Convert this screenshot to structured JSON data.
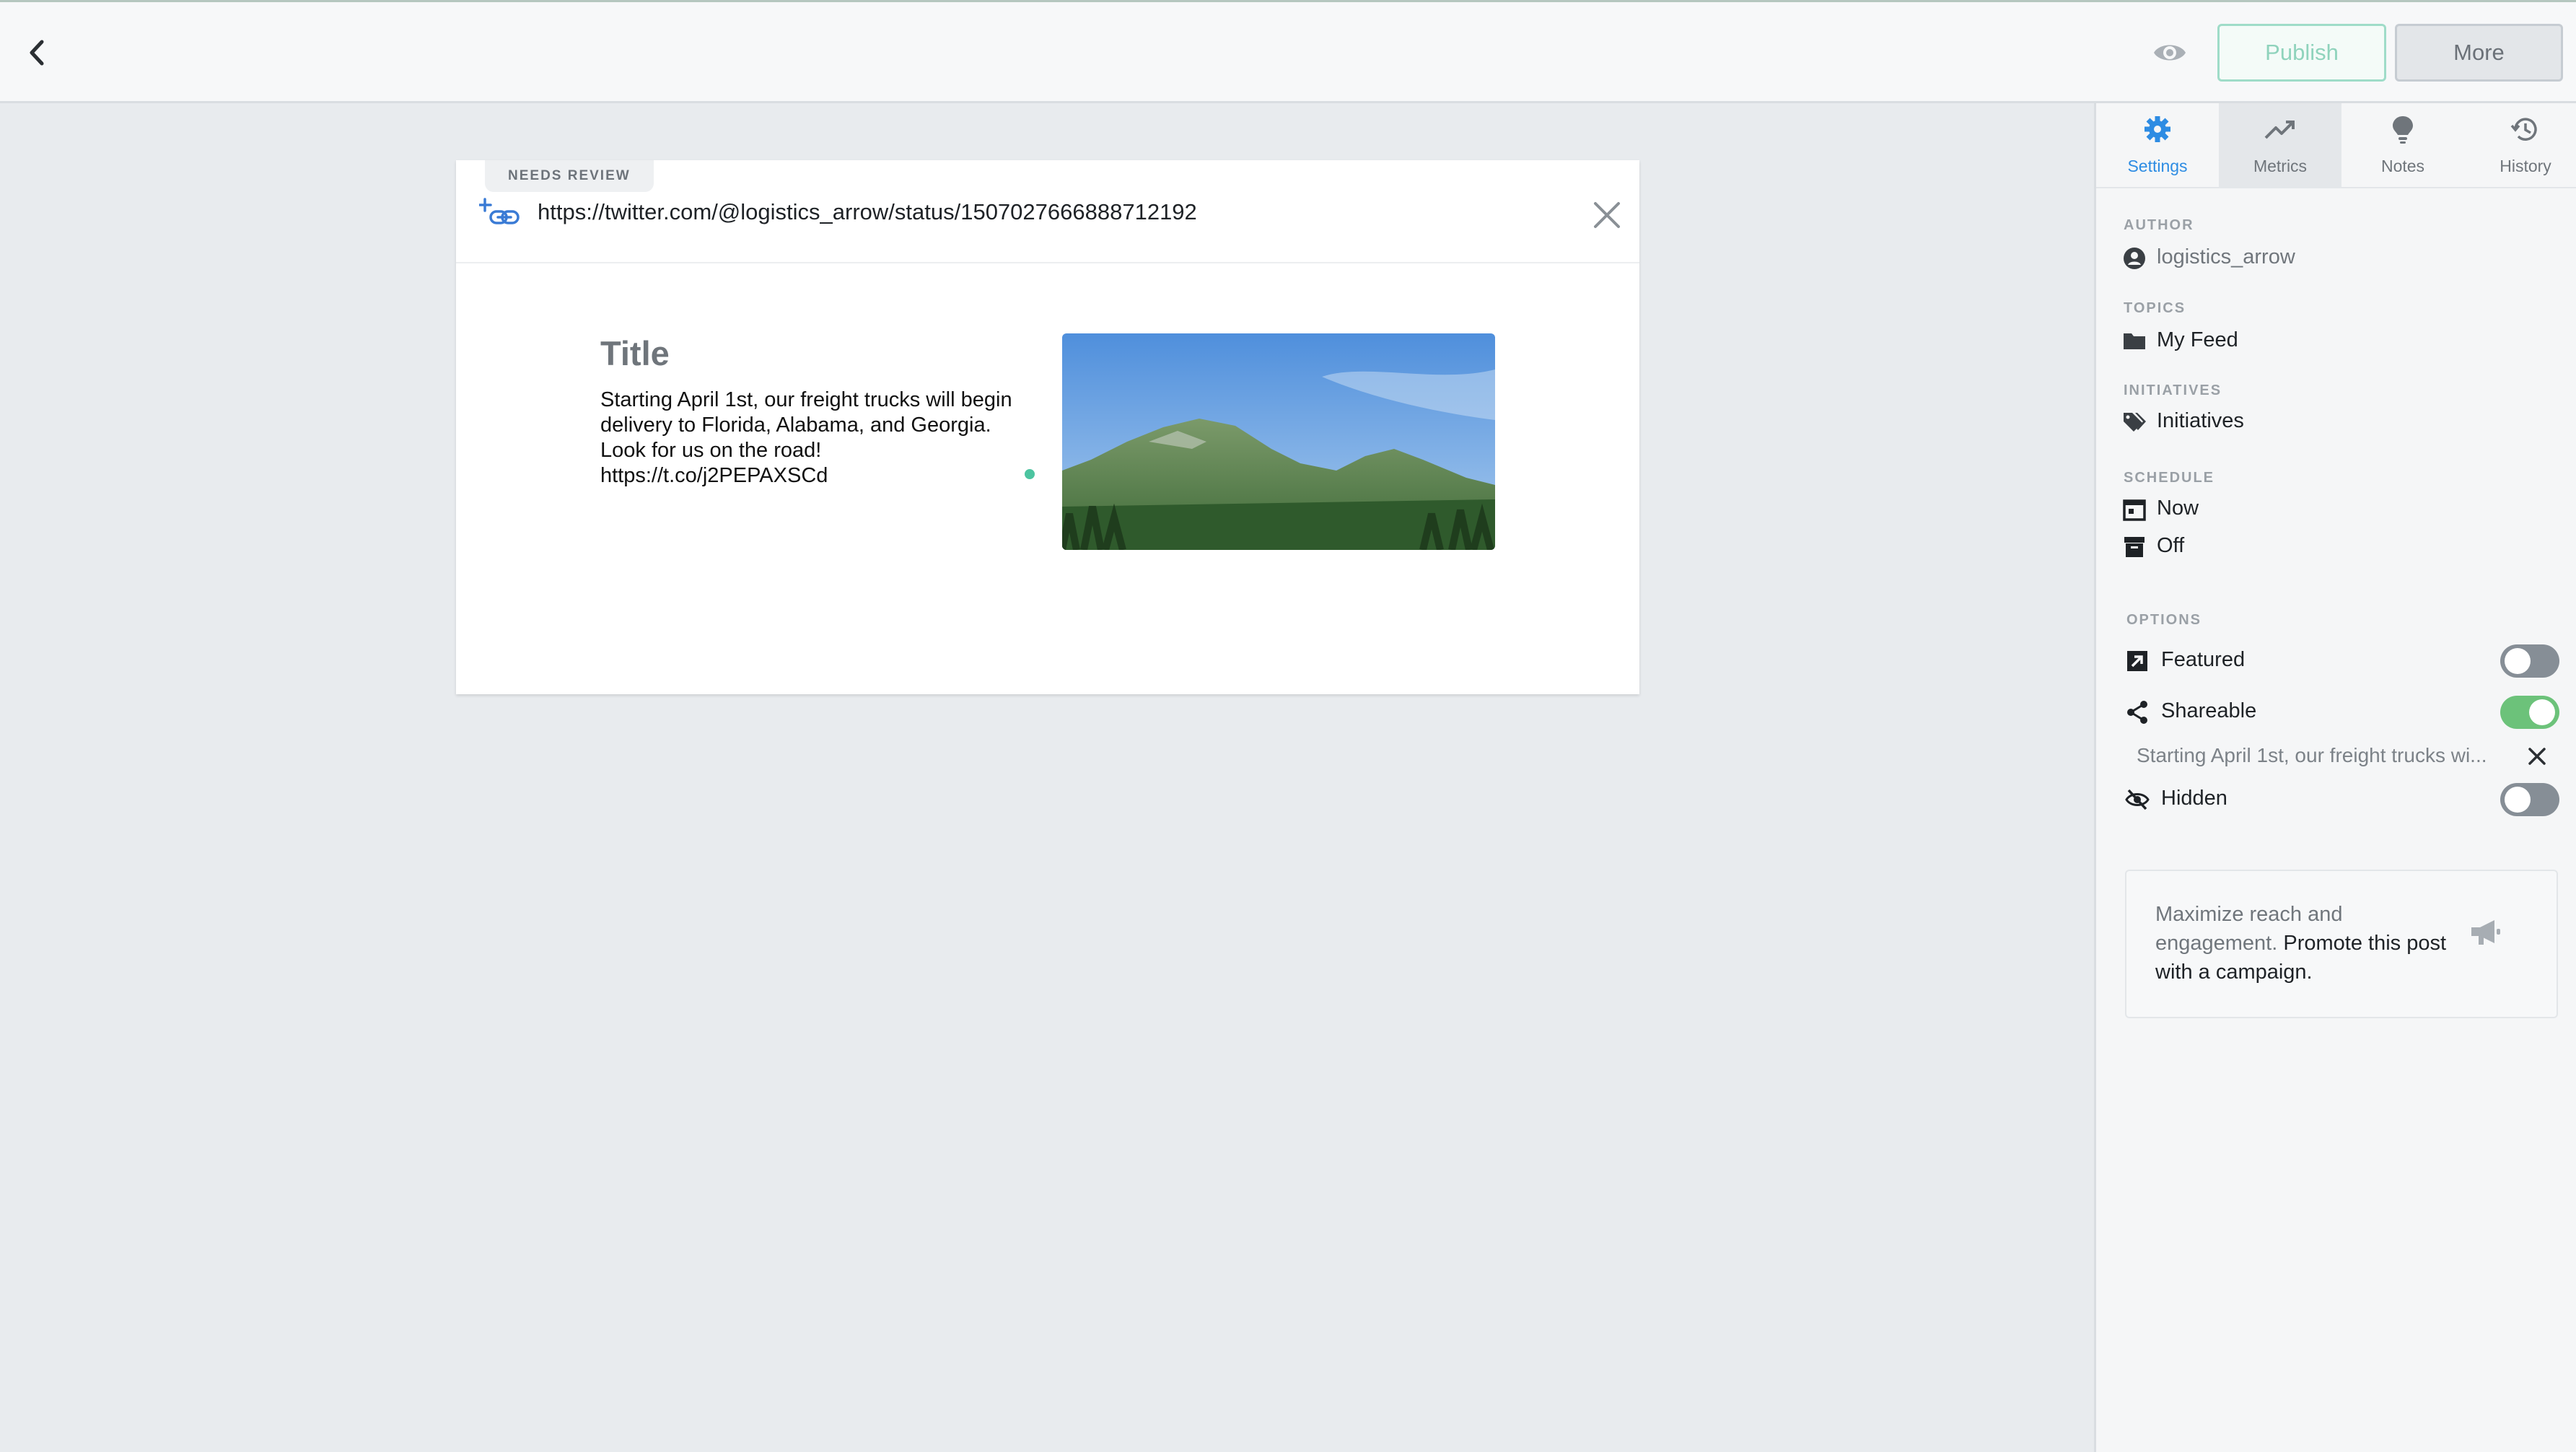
{
  "topbar": {
    "back_icon": "chevron-left-icon",
    "preview_icon": "eye-icon",
    "publish_label": "Publish",
    "more_label": "More"
  },
  "post": {
    "status_badge": "NEEDS REVIEW",
    "url": "https://twitter.com/@logistics_arrow/status/1507027666888712192",
    "preview": {
      "title": "Title",
      "body_lines": [
        "Starting April 1st, our freight trucks will begin",
        "delivery to Florida, Alabama, and Georgia.",
        "Look for us on the road!",
        "https://t.co/j2PEPAXSCd"
      ]
    }
  },
  "sidebar": {
    "tabs": [
      {
        "label": "Settings",
        "icon": "gear-icon"
      },
      {
        "label": "Metrics",
        "icon": "trend-icon"
      },
      {
        "label": "Notes",
        "icon": "lightbulb-icon"
      },
      {
        "label": "History",
        "icon": "history-icon"
      }
    ],
    "author": {
      "label": "AUTHOR",
      "value": "logistics_arrow"
    },
    "topics": {
      "label": "TOPICS",
      "value": "My Feed"
    },
    "initiatives": {
      "label": "INITIATIVES",
      "value": "Initiatives"
    },
    "schedule": {
      "label": "SCHEDULE",
      "start": "Now",
      "end": "Off"
    },
    "options": {
      "label": "OPTIONS",
      "featured": {
        "label": "Featured",
        "on": false
      },
      "shareable": {
        "label": "Shareable",
        "on": true,
        "text": "Starting April 1st, our freight trucks wi..."
      },
      "hidden": {
        "label": "Hidden",
        "on": false
      }
    },
    "promo": {
      "text": "Maximize reach and engagement.",
      "cta": "Promote this post with a campaign."
    }
  },
  "colors": {
    "accent_blue": "#2d8ce3",
    "toggle_on": "#6cc27a",
    "toggle_off": "#868e96",
    "publish_green": "#8fd3bc"
  }
}
